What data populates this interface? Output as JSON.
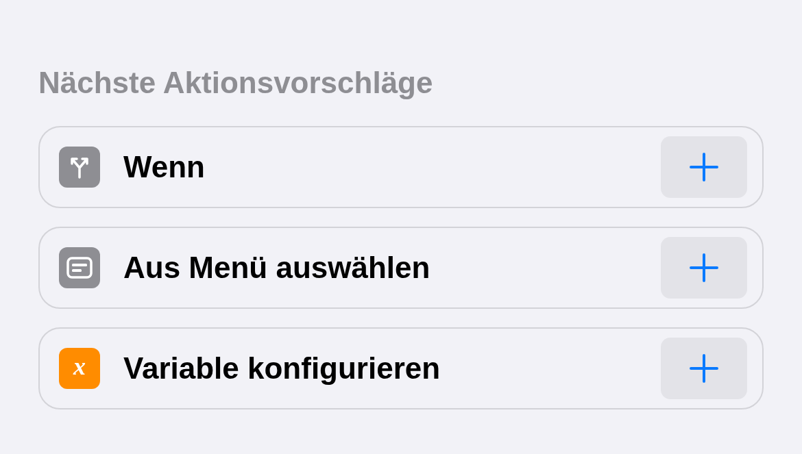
{
  "section": {
    "title": "Nächste Aktionsvorschläge"
  },
  "suggestions": [
    {
      "label": "Wenn",
      "kind": "branch",
      "color": "#8e8e93"
    },
    {
      "label": "Aus Menü auswählen",
      "kind": "menu",
      "color": "#8e8e93"
    },
    {
      "label": "Variable konfigurieren",
      "kind": "variable",
      "color": "#ff8c00",
      "glyph": "x"
    }
  ]
}
